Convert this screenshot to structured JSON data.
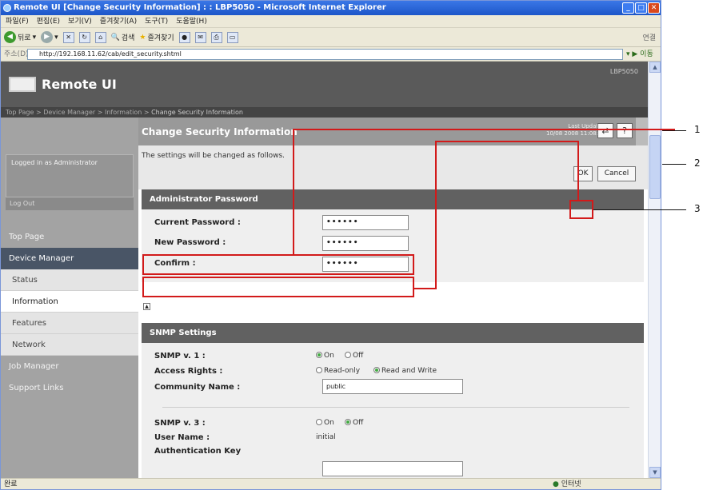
{
  "window": {
    "title": "Remote UI [Change Security Information] : : LBP5050 - Microsoft Internet Explorer"
  },
  "menu": [
    "파일(F)",
    "편집(E)",
    "보기(V)",
    "즐겨찾기(A)",
    "도구(T)",
    "도움말(H)"
  ],
  "toolbar": {
    "back_label": "뒤로",
    "search_label": "검색",
    "favorites_label": "즐겨찾기",
    "links_label": "연결"
  },
  "address": {
    "label": "주소(D)",
    "url": "http://192.168.11.62/cab/edit_security.shtml",
    "go_label": "이동"
  },
  "remoteui": {
    "logo": "Remote UI",
    "model": "LBP5050"
  },
  "breadcrumb": {
    "top": "Top Page",
    "sep1": " > ",
    "device": "Device Manager",
    "sep2": " > ",
    "info": "Information",
    "sep3": " > ",
    "current": "Change Security Information"
  },
  "sidebar": {
    "logged_in": "Logged in as Administrator",
    "logout": "Log Out",
    "items": [
      "Top Page",
      "Device Manager",
      "Status",
      "Information",
      "Features",
      "Network",
      "Job Manager",
      "Support Links"
    ]
  },
  "page": {
    "title": "Change Security Information",
    "last_updated_label": "Last Updated",
    "last_updated_value": "10/08 2008 11:08:26",
    "refresh_icon": "refresh-icon",
    "help_label": "?",
    "message": "The settings will be changed as follows.",
    "ok_label": "OK",
    "cancel_label": "Cancel"
  },
  "admin": {
    "heading": "Administrator Password",
    "current_label": "Current Password :",
    "current_value": "••••••",
    "new_label": "New Password :",
    "new_value": "••••••",
    "confirm_label": "Confirm :",
    "confirm_value": "••••••"
  },
  "snmp": {
    "heading": "SNMP Settings",
    "v1_label": "SNMP v. 1 :",
    "v1_on": "On",
    "v1_off": "Off",
    "access_label": "Access Rights :",
    "access_ro": "Read-only",
    "access_rw": "Read and Write",
    "community_label": "Community Name :",
    "community_value": "public",
    "v3_label": "SNMP v. 3 :",
    "v3_on": "On",
    "v3_off": "Off",
    "user_label": "User Name :",
    "user_value": "initial",
    "auth_label": "Authentication Key"
  },
  "status": {
    "left": "완료",
    "zone": "인터넷"
  },
  "callouts": [
    "1",
    "2",
    "3"
  ]
}
